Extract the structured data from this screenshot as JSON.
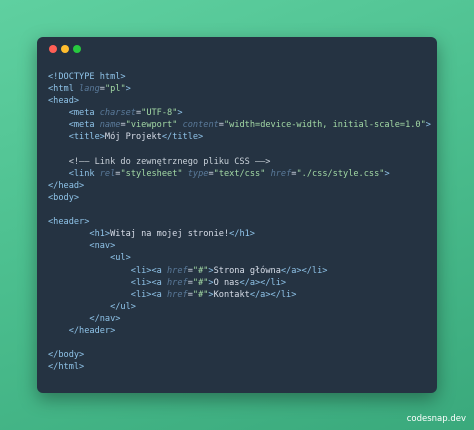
{
  "window": {
    "buttons": [
      "close",
      "minimize",
      "maximize"
    ],
    "colors": {
      "close": "#ff5f56",
      "minimize": "#ffbd2e",
      "maximize": "#27c93f"
    }
  },
  "code_lines": [
    [
      {
        "t": "<!DOCTYPE html>",
        "c": "tag"
      }
    ],
    [
      {
        "t": "<html ",
        "c": "tag"
      },
      {
        "t": "lang",
        "c": "attr"
      },
      {
        "t": "=",
        "c": "eq"
      },
      {
        "t": "\"pl\"",
        "c": "str"
      },
      {
        "t": ">",
        "c": "tag"
      }
    ],
    [
      {
        "t": "<head>",
        "c": "tag"
      }
    ],
    [
      {
        "t": "    <meta ",
        "c": "tag"
      },
      {
        "t": "charset",
        "c": "attr"
      },
      {
        "t": "=",
        "c": "eq"
      },
      {
        "t": "\"UTF-8\"",
        "c": "str"
      },
      {
        "t": ">",
        "c": "tag"
      }
    ],
    [
      {
        "t": "    <meta ",
        "c": "tag"
      },
      {
        "t": "name",
        "c": "attr"
      },
      {
        "t": "=",
        "c": "eq"
      },
      {
        "t": "\"viewport\"",
        "c": "str"
      },
      {
        "t": " ",
        "c": "text"
      },
      {
        "t": "content",
        "c": "attr"
      },
      {
        "t": "=",
        "c": "eq"
      },
      {
        "t": "\"width=device-width, initial-scale=1.0\"",
        "c": "str"
      },
      {
        "t": ">",
        "c": "tag"
      }
    ],
    [
      {
        "t": "    <title>",
        "c": "tag"
      },
      {
        "t": "Mój Projekt",
        "c": "text"
      },
      {
        "t": "</title>",
        "c": "tag"
      }
    ],
    [
      {
        "t": "",
        "c": "text"
      }
    ],
    [
      {
        "t": "    <!—— Link do zewnętrznego pliku CSS ——>",
        "c": "comment"
      }
    ],
    [
      {
        "t": "    <link ",
        "c": "tag"
      },
      {
        "t": "rel",
        "c": "attr"
      },
      {
        "t": "=",
        "c": "eq"
      },
      {
        "t": "\"stylesheet\"",
        "c": "str"
      },
      {
        "t": " ",
        "c": "text"
      },
      {
        "t": "type",
        "c": "attr"
      },
      {
        "t": "=",
        "c": "eq"
      },
      {
        "t": "\"text/css\"",
        "c": "str"
      },
      {
        "t": " ",
        "c": "text"
      },
      {
        "t": "href",
        "c": "attr"
      },
      {
        "t": "=",
        "c": "eq"
      },
      {
        "t": "\"./css/style.css\"",
        "c": "str"
      },
      {
        "t": ">",
        "c": "tag"
      }
    ],
    [
      {
        "t": "</head>",
        "c": "tag"
      }
    ],
    [
      {
        "t": "<body>",
        "c": "tag"
      }
    ],
    [
      {
        "t": "",
        "c": "text"
      }
    ],
    [
      {
        "t": "<header>",
        "c": "tag"
      }
    ],
    [
      {
        "t": "        <h1>",
        "c": "tag"
      },
      {
        "t": "Witaj na mojej stronie!",
        "c": "text"
      },
      {
        "t": "</h1>",
        "c": "tag"
      }
    ],
    [
      {
        "t": "        <nav>",
        "c": "tag"
      }
    ],
    [
      {
        "t": "            <ul>",
        "c": "tag"
      }
    ],
    [
      {
        "t": "                <li><a ",
        "c": "tag"
      },
      {
        "t": "href",
        "c": "attr"
      },
      {
        "t": "=",
        "c": "eq"
      },
      {
        "t": "\"#\"",
        "c": "str"
      },
      {
        "t": ">",
        "c": "tag"
      },
      {
        "t": "Strona główna",
        "c": "text"
      },
      {
        "t": "</a></li>",
        "c": "tag"
      }
    ],
    [
      {
        "t": "                <li><a ",
        "c": "tag"
      },
      {
        "t": "href",
        "c": "attr"
      },
      {
        "t": "=",
        "c": "eq"
      },
      {
        "t": "\"#\"",
        "c": "str"
      },
      {
        "t": ">",
        "c": "tag"
      },
      {
        "t": "O nas",
        "c": "text"
      },
      {
        "t": "</a></li>",
        "c": "tag"
      }
    ],
    [
      {
        "t": "                <li><a ",
        "c": "tag"
      },
      {
        "t": "href",
        "c": "attr"
      },
      {
        "t": "=",
        "c": "eq"
      },
      {
        "t": "\"#\"",
        "c": "str"
      },
      {
        "t": ">",
        "c": "tag"
      },
      {
        "t": "Kontakt",
        "c": "text"
      },
      {
        "t": "</a></li>",
        "c": "tag"
      }
    ],
    [
      {
        "t": "            </ul>",
        "c": "tag"
      }
    ],
    [
      {
        "t": "        </nav>",
        "c": "tag"
      }
    ],
    [
      {
        "t": "    </header>",
        "c": "tag"
      }
    ],
    [
      {
        "t": "",
        "c": "text"
      }
    ],
    [
      {
        "t": "</body>",
        "c": "tag"
      }
    ],
    [
      {
        "t": "</html>",
        "c": "tag"
      }
    ]
  ],
  "watermark": "codesnap.dev"
}
